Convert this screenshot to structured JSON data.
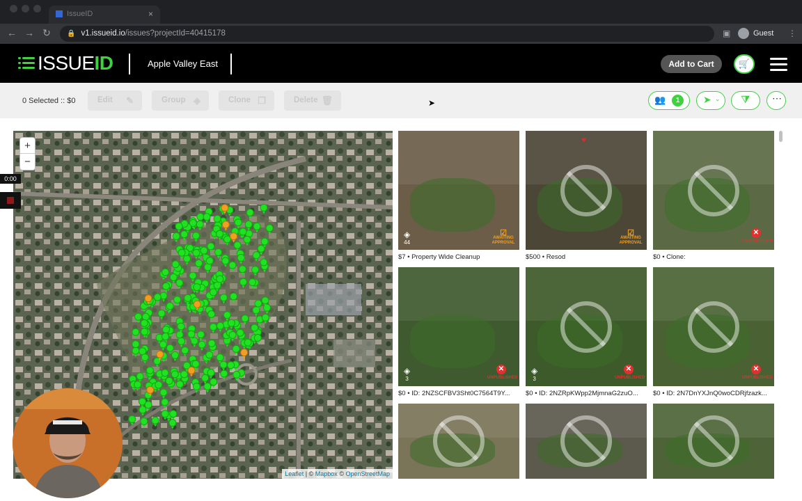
{
  "browser": {
    "tab_title": "IssueID",
    "url_host": "v1.issueid.io",
    "url_path": "/issues?projectId=40415178",
    "profile_label": "Guest"
  },
  "header": {
    "logo_main": "ISSUE",
    "logo_accent": "ID",
    "project_name": "Apple Valley East",
    "add_to_cart_label": "Add to Cart"
  },
  "actions": {
    "selected_text": "0 Selected :: $0",
    "edit_label": "Edit",
    "group_label": "Group",
    "clone_label": "Clone",
    "delete_label": "Delete",
    "people_count": "1"
  },
  "map": {
    "zoom_in": "+",
    "zoom_out": "−",
    "attribution": {
      "leaflet": "Leaflet",
      "sep1": " | © ",
      "mapbox": "Mapbox",
      "sep2": " © ",
      "osm": "OpenStreetMap"
    }
  },
  "recorder": {
    "timer": "0:00"
  },
  "gallery": [
    {
      "caption": "$7 • Property Wide Cleanup",
      "stack_count": "44",
      "status": "AWAITING APPROVAL",
      "bg": "#6b5d48"
    },
    {
      "caption": "$500 • Resod",
      "stack_count": "",
      "status": "AWAITING APPROVAL",
      "bg": "#4b4636"
    },
    {
      "caption": "$0 • Clone:",
      "stack_count": "",
      "status": "UNPUBLISHED",
      "bg": "#5b6a45"
    },
    {
      "caption": "$0 • ID: 2NZSCFBV3Sht0C7564T9Y...",
      "stack_count": "3",
      "status": "UNPUBLISHED",
      "bg": "#3f5a2e"
    },
    {
      "caption": "$0 • ID: 2NZRpKWpp2MjmnaG2zuO...",
      "stack_count": "3",
      "status": "UNPUBLISHED",
      "bg": "#3d5a2a"
    },
    {
      "caption": "$0 • ID: 2N7DnYXJnQ0woCDRjfzazk...",
      "stack_count": "",
      "status": "UNPUBLISHED",
      "bg": "#4a6233"
    },
    {
      "caption": "",
      "stack_count": "",
      "status": "",
      "bg": "#7a7458"
    },
    {
      "caption": "",
      "stack_count": "",
      "status": "",
      "bg": "#5c5a4c"
    },
    {
      "caption": "",
      "stack_count": "",
      "status": "",
      "bg": "#4e6438"
    }
  ]
}
